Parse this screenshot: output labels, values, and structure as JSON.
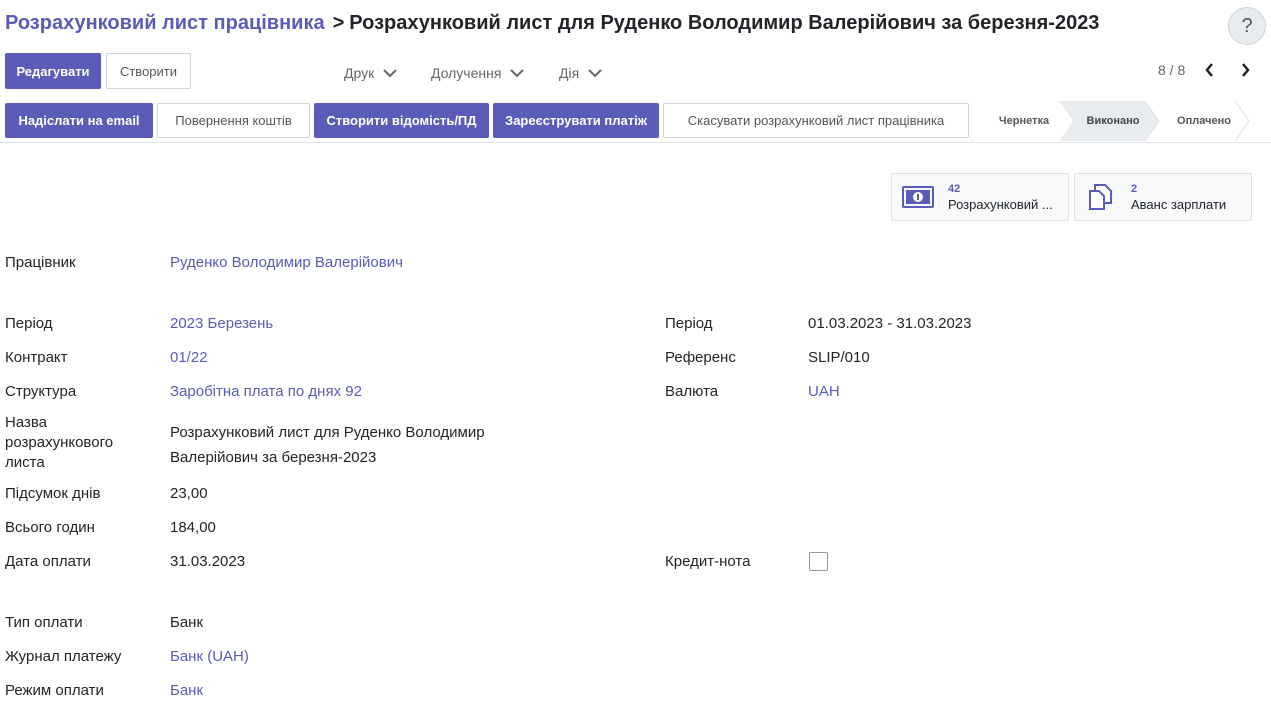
{
  "breadcrumb": {
    "parent": "Розрахунковий лист працівника",
    "current": "Розрахунковий лист для Руденко Володимир Валерійович за березня-2023"
  },
  "help": "?",
  "toolbar": {
    "edit": "Редагувати",
    "create": "Створити",
    "print": "Друк",
    "attachments": "Долучення",
    "action": "Дія",
    "pager": "8 / 8"
  },
  "actions": {
    "email": "Надіслати на email",
    "refund": "Повернення коштів",
    "create_sheet": "Створити відомість/ПД",
    "register_payment": "Зареєструвати платіж",
    "cancel": "Скасувати розрахунковий лист працівника"
  },
  "statusbar": {
    "stages": [
      "Чернетка",
      "Виконано",
      "Оплачено"
    ],
    "active": "Виконано"
  },
  "smart_buttons": {
    "payslips": {
      "count": "42",
      "label": "Розрахунковий ..."
    },
    "advance": {
      "count": "2",
      "label": "Аванс зарплати"
    }
  },
  "form": {
    "employee": {
      "label": "Працівник",
      "value": "Руденко Володимир Валерійович"
    },
    "period": {
      "label": "Період",
      "value": "2023 Березень"
    },
    "contract": {
      "label": "Контракт",
      "value": "01/22"
    },
    "structure": {
      "label": "Структура",
      "value": "Заробітна плата по днях 92"
    },
    "payslip_name": {
      "label_lines": [
        "Назва",
        "розрахункового",
        "листа"
      ],
      "value_lines": [
        "Розрахунковий лист для Руденко Володимир",
        "Валерійович за березня-2023"
      ]
    },
    "days_total": {
      "label": "Підсумок днів",
      "value": "23,00"
    },
    "hours_total": {
      "label": "Всього годин",
      "value": "184,00"
    },
    "pay_date": {
      "label": "Дата оплати",
      "value": "31.03.2023"
    },
    "payment_type": {
      "label": "Тип оплати",
      "value": "Банк"
    },
    "payment_journal": {
      "label": "Журнал платежу",
      "value": "Банк (UAH)"
    },
    "payment_mode": {
      "label": "Режим оплати",
      "value": "Банк"
    },
    "date_range": {
      "label": "Період",
      "value": "01.03.2023 - 31.03.2023"
    },
    "reference": {
      "label": "Референс",
      "value": "SLIP/010"
    },
    "currency": {
      "label": "Валюта",
      "value": "UAH"
    },
    "credit_note": {
      "label": "Кредит-нота",
      "checked": false
    }
  },
  "colors": {
    "primary": "#5b5bb8",
    "link": "#5b5bb8"
  }
}
